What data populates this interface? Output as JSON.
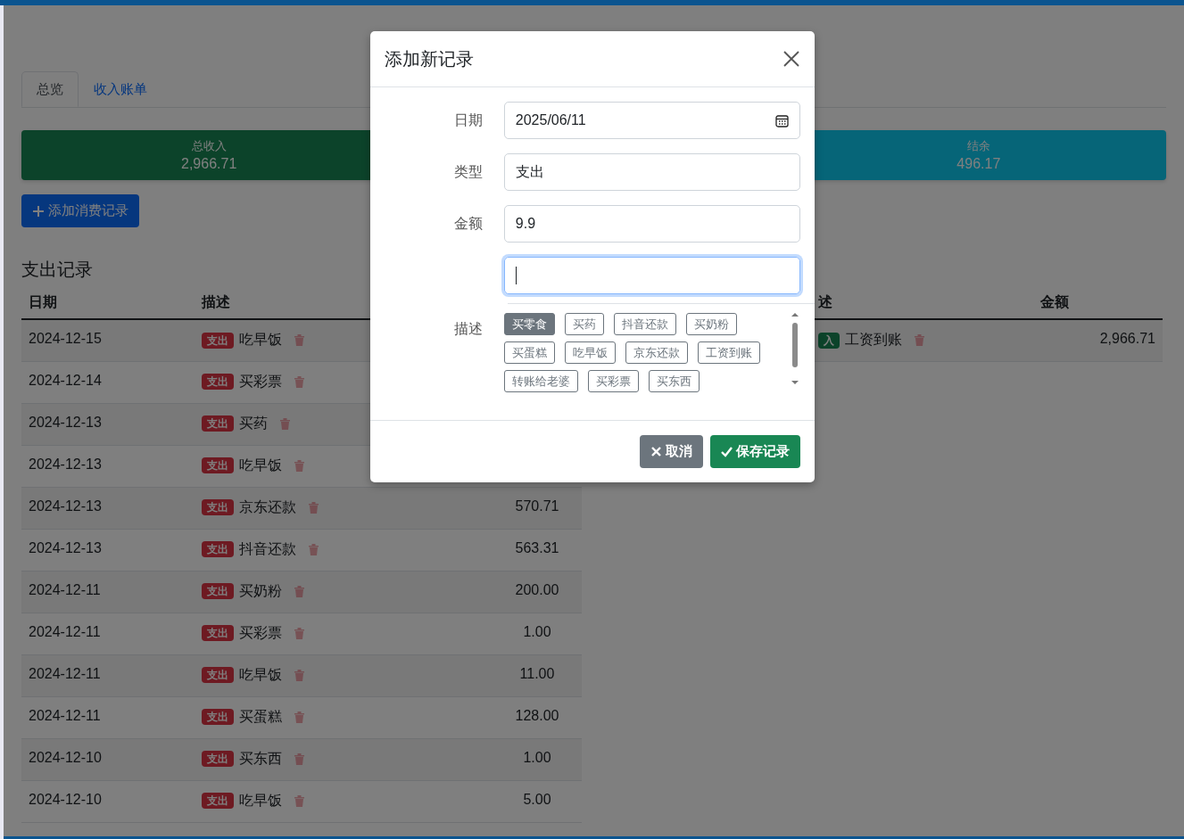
{
  "tabs": [
    {
      "label": "总览",
      "selected": true
    },
    {
      "label": "收入账单",
      "selected": false
    }
  ],
  "summary_cards": [
    {
      "kind": "income",
      "label": "总收入",
      "value": "2,966.71"
    },
    {
      "kind": "balance",
      "label": "结余",
      "value": "496.17"
    }
  ],
  "add_button": {
    "label": "添加消费记录"
  },
  "expense_section": {
    "heading": "支出记录",
    "columns": [
      "日期",
      "描述"
    ],
    "rows": [
      {
        "date": "2024-12-15",
        "kind": "expense",
        "badge": "支出",
        "description": "吃早饭"
      },
      {
        "date": "2024-12-14",
        "kind": "expense",
        "badge": "支出",
        "description": "买彩票"
      },
      {
        "date": "2024-12-13",
        "kind": "expense",
        "badge": "支出",
        "description": "买药"
      },
      {
        "date": "2024-12-13",
        "kind": "expense",
        "badge": "支出",
        "description": "吃早饭"
      },
      {
        "date": "2024-12-13",
        "kind": "expense",
        "badge": "支出",
        "description": "京东还款",
        "amount": "570.71"
      },
      {
        "date": "2024-12-13",
        "kind": "expense",
        "badge": "支出",
        "description": "抖音还款",
        "amount": "563.31"
      },
      {
        "date": "2024-12-11",
        "kind": "expense",
        "badge": "支出",
        "description": "买奶粉",
        "amount": "200.00"
      },
      {
        "date": "2024-12-11",
        "kind": "expense",
        "badge": "支出",
        "description": "买彩票",
        "amount": "1.00"
      },
      {
        "date": "2024-12-11",
        "kind": "expense",
        "badge": "支出",
        "description": "吃早饭",
        "amount": "11.00"
      },
      {
        "date": "2024-12-11",
        "kind": "expense",
        "badge": "支出",
        "description": "买蛋糕",
        "amount": "128.00"
      },
      {
        "date": "2024-12-10",
        "kind": "expense",
        "badge": "支出",
        "description": "买东西",
        "amount": "1.00"
      },
      {
        "date": "2024-12-10",
        "kind": "expense",
        "badge": "支出",
        "description": "吃早饭",
        "amount": "5.00"
      }
    ]
  },
  "income_section": {
    "columns": [
      "述",
      "金额"
    ],
    "rows": [
      {
        "kind": "income",
        "badge": "入",
        "description": "工资到账",
        "amount": "2,966.71"
      }
    ]
  },
  "modal": {
    "title": "添加新记录",
    "fields": [
      {
        "kind": "date",
        "label": "日期",
        "value": "2025/06/11",
        "focused": false
      },
      {
        "kind": "text",
        "label": "类型",
        "value": "支出",
        "focused": false
      },
      {
        "kind": "text",
        "label": "金额",
        "value": "9.9",
        "focused": false
      },
      {
        "kind": "text",
        "focused": true
      }
    ],
    "description": {
      "label": "描述",
      "tags": [
        {
          "label": "买零食",
          "selected": true
        },
        {
          "label": "买药",
          "selected": false
        },
        {
          "label": "抖音还款",
          "selected": false
        },
        {
          "label": "买奶粉",
          "selected": false
        },
        {
          "label": "买蛋糕",
          "selected": false
        },
        {
          "label": "吃早饭",
          "selected": false
        },
        {
          "label": "京东还款",
          "selected": false
        },
        {
          "label": "工资到账",
          "selected": false
        },
        {
          "label": "转账给老婆",
          "selected": false
        },
        {
          "label": "买彩票",
          "selected": false
        },
        {
          "label": "买东西",
          "selected": false
        }
      ]
    },
    "buttons": [
      {
        "kind": "cancel",
        "label": "取消"
      },
      {
        "kind": "save",
        "label": "保存记录"
      }
    ]
  }
}
